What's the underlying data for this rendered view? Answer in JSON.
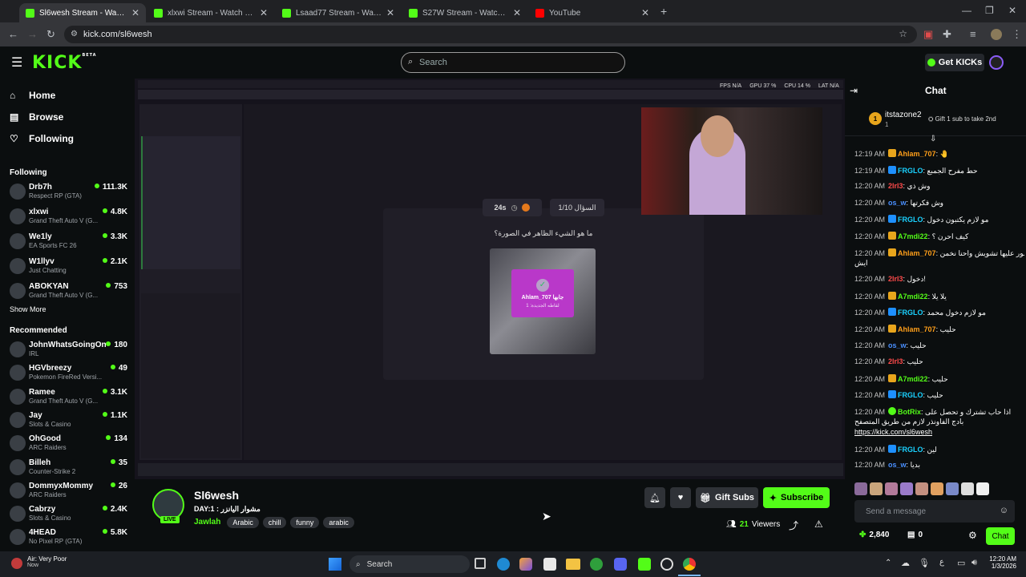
{
  "browser": {
    "tabs": [
      {
        "title": "Sl6wesh Stream - Watch Live on Kick",
        "active": true,
        "icon": "kick-icon"
      },
      {
        "title": "xlxwi Stream - Watch Live on Kick",
        "active": false,
        "icon": "kick-icon"
      },
      {
        "title": "Lsaad77 Stream - Watch Live on Kick",
        "active": false,
        "icon": "kick-icon"
      },
      {
        "title": "S27W Stream - Watch Live on Kick",
        "active": false,
        "icon": "kick-icon"
      },
      {
        "title": "YouTube",
        "active": false,
        "icon": "youtube-icon"
      }
    ],
    "url": "kick.com/sl6wesh"
  },
  "header": {
    "logo": "KICK",
    "logo_badge": "BETA",
    "search_placeholder": "Search",
    "get_kicks": "Get KICKs"
  },
  "sidebar": {
    "nav": [
      {
        "label": "Home",
        "icon": "home-icon"
      },
      {
        "label": "Browse",
        "icon": "browse-icon"
      },
      {
        "label": "Following",
        "icon": "heart-icon"
      }
    ],
    "following_title": "Following",
    "following": [
      {
        "name": "Drb7h",
        "game": "Respect RP (GTA)",
        "viewers": "111.3K"
      },
      {
        "name": "xlxwi",
        "game": "Grand Theft Auto V (G...",
        "viewers": "4.8K"
      },
      {
        "name": "We1ly",
        "game": "EA Sports FC 26",
        "viewers": "3.3K"
      },
      {
        "name": "W1llyv",
        "game": "Just Chatting",
        "viewers": "2.1K"
      },
      {
        "name": "ABOKYAN",
        "game": "Grand Theft Auto V (G...",
        "viewers": "753"
      }
    ],
    "show_more": "Show More",
    "recommended_title": "Recommended",
    "recommended": [
      {
        "name": "JohnWhatsGoingOn",
        "game": "IRL",
        "viewers": "180"
      },
      {
        "name": "HGVbreezy",
        "game": "Pokemon FireRed Versi...",
        "viewers": "49"
      },
      {
        "name": "Ramee",
        "game": "Grand Theft Auto V (G...",
        "viewers": "3.1K"
      },
      {
        "name": "Jay",
        "game": "Slots & Casino",
        "viewers": "1.1K"
      },
      {
        "name": "OhGood",
        "game": "ARC Raiders",
        "viewers": "134"
      },
      {
        "name": "Billeh",
        "game": "Counter-Strike 2",
        "viewers": "35"
      },
      {
        "name": "DommyxMommy",
        "game": "ARC Raiders",
        "viewers": "26"
      },
      {
        "name": "Cabrzy",
        "game": "Slots & Casino",
        "viewers": "2.4K"
      },
      {
        "name": "4HEAD",
        "game": "No Pixel RP (GTA)",
        "viewers": "5.8K"
      }
    ]
  },
  "video": {
    "stats": [
      "FPS N/A",
      "GPU 37 %",
      "CPU 14 %",
      "LAT N/A"
    ],
    "timer": "24s",
    "question_counter": "السؤال 1/10",
    "question": "ما هو الشيء الظاهر في الصورة؟",
    "answer_name": "Ahlam_707 جابها",
    "answer_sub": "لقاطه الجديدة: 1"
  },
  "stream": {
    "streamer": "Sl6wesh",
    "live_label": "LIVE",
    "title": "DAY:1 : مشوار اليانزر",
    "category": "Jawlah",
    "tags": [
      "Arabic",
      "chill",
      "funny",
      "arabic"
    ],
    "gift_subs": "Gift Subs",
    "subscribe": "Subscribe",
    "viewers": "21",
    "viewers_label": "Viewers"
  },
  "chat": {
    "title": "Chat",
    "pinned_user": "itstazone2",
    "pinned_rank": "1",
    "pinned_count": "1",
    "gift_prompt": "Gift 1 sub to take 2nd",
    "messages": [
      {
        "time": "12:19 AM",
        "user": "Ahlam_707",
        "color": "#ff9f1a",
        "badge": "crown",
        "text": "🤚"
      },
      {
        "time": "12:19 AM",
        "user": "FRGLO",
        "color": "#1ad1ff",
        "badge": "sub",
        "text": "حط مفرح الجمبع"
      },
      {
        "time": "12:20 AM",
        "user": "2lrl3",
        "color": "#ff4a4a",
        "badge": "none",
        "text": "وش ذي"
      },
      {
        "time": "12:20 AM",
        "user": "os_w",
        "color": "#4a90ff",
        "badge": "none",
        "text": "وش فكرتها"
      },
      {
        "time": "12:20 AM",
        "user": "FRGLO",
        "color": "#1ad1ff",
        "badge": "sub",
        "text": "مو لازم يكتبون دخول"
      },
      {
        "time": "12:20 AM",
        "user": "A7mdi22",
        "color": "#53fc18",
        "badge": "crown",
        "text": "كيف احرن ؟"
      },
      {
        "time": "12:20 AM",
        "user": "Ahlam_707",
        "color": "#ff9f1a",
        "badge": "crown",
        "text": "صور عليها تشويش واحنا نخمن"
      },
      {
        "time": "",
        "user": "",
        "color": "#ffffff",
        "badge": "none",
        "text": "ايش"
      },
      {
        "time": "12:20 AM",
        "user": "2lrl3",
        "color": "#ff4a4a",
        "badge": "none",
        "text": "دخول!"
      },
      {
        "time": "12:20 AM",
        "user": "A7mdi22",
        "color": "#53fc18",
        "badge": "crown",
        "text": "يلا يلا"
      },
      {
        "time": "12:20 AM",
        "user": "FRGLO",
        "color": "#1ad1ff",
        "badge": "sub",
        "text": "مو لازم دخول محمد"
      },
      {
        "time": "12:20 AM",
        "user": "Ahlam_707",
        "color": "#ff9f1a",
        "badge": "crown",
        "text": "حليب"
      },
      {
        "time": "12:20 AM",
        "user": "os_w",
        "color": "#4a90ff",
        "badge": "none",
        "text": "حليب"
      },
      {
        "time": "12:20 AM",
        "user": "2lrl3",
        "color": "#ff4a4a",
        "badge": "none",
        "text": "حليب"
      },
      {
        "time": "12:20 AM",
        "user": "A7mdi22",
        "color": "#53fc18",
        "badge": "crown",
        "text": "حليب"
      },
      {
        "time": "12:20 AM",
        "user": "FRGLO",
        "color": "#1ad1ff",
        "badge": "sub",
        "text": "حليب"
      },
      {
        "time": "12:20 AM",
        "user": "BotRix",
        "color": "#53fc18",
        "badge": "bot",
        "text": "اذا حاب تشترك و تحصل على"
      },
      {
        "time": "",
        "user": "",
        "color": "#ffffff",
        "badge": "none",
        "text": "بادج الفاونذر لازم من طريق المتصفح"
      },
      {
        "time": "",
        "user": "",
        "color": "#ffffff",
        "badge": "link",
        "text": "https://kick.com/sl6wesh"
      },
      {
        "time": "12:20 AM",
        "user": "FRGLO",
        "color": "#1ad1ff",
        "badge": "sub",
        "text": "لين"
      },
      {
        "time": "12:20 AM",
        "user": "os_w",
        "color": "#4a90ff",
        "badge": "none",
        "text": "بديا"
      }
    ],
    "input_placeholder": "Send a message",
    "kicks": "2,840",
    "points": "0",
    "chat_button": "Chat"
  },
  "taskbar": {
    "weather": "Air: Very Poor",
    "weather_sub": "Now",
    "search": "Search",
    "time": "12:20 AM",
    "date": "1/3/2026"
  },
  "colors": {
    "accent": "#53fc18",
    "background": "#0b0e0f",
    "chat_link": "#ffffff"
  }
}
